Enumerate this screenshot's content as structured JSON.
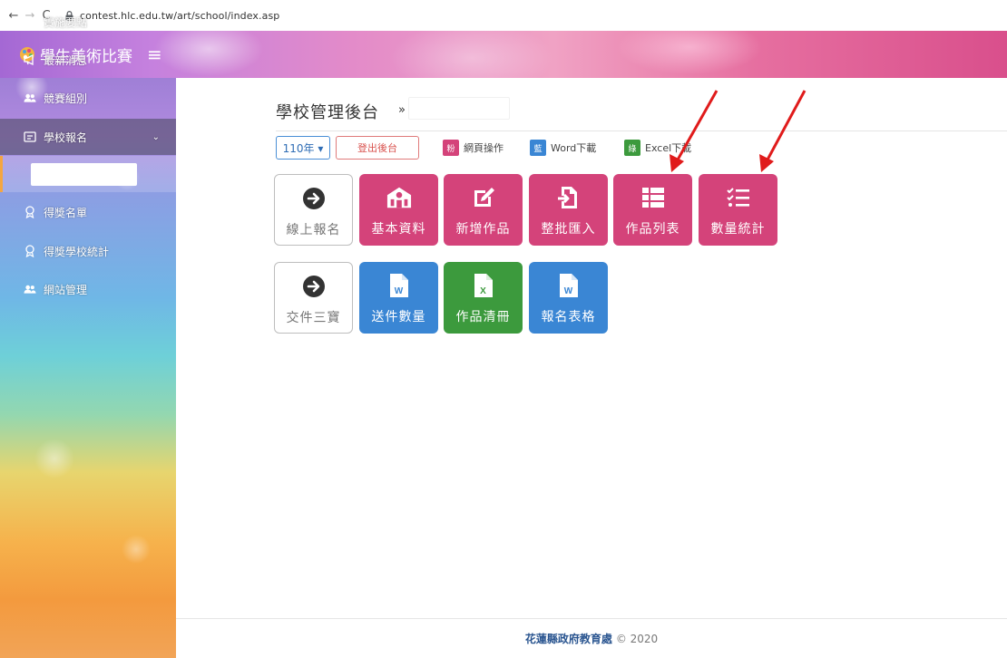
{
  "browser": {
    "back": "←",
    "forward": "→",
    "reload": "C",
    "url": "contest.hlc.edu.tw/art/school/index.asp"
  },
  "brand": {
    "title": "學生美術比賽",
    "menu_toggle": "≡"
  },
  "sidebar": {
    "items": [
      {
        "label": "實施要點",
        "icon": "file-icon"
      },
      {
        "label": "最新消息",
        "icon": "megaphone-icon"
      },
      {
        "label": "競賽組別",
        "icon": "users-icon"
      },
      {
        "label": "學校報名",
        "icon": "signup-icon",
        "active": true,
        "caret": "⌄"
      },
      {
        "label": "得獎名單",
        "icon": "award-icon"
      },
      {
        "label": "得獎學校統計",
        "icon": "award-icon"
      },
      {
        "label": "網站管理",
        "icon": "users-icon"
      }
    ]
  },
  "main": {
    "title": "學校管理後台",
    "raquo": "»",
    "year_select": "110年 ▾",
    "logout": "登出後台",
    "legend": [
      {
        "swatch": "粉",
        "label": "網頁操作",
        "color": "#d4437a"
      },
      {
        "swatch": "藍",
        "label": "Word下載",
        "color": "#3a86d4"
      },
      {
        "swatch": "綠",
        "label": "Excel下載",
        "color": "#3c9a3d"
      }
    ],
    "row1": [
      {
        "label": "線上報名",
        "icon": "arrow-circle-right-icon",
        "style": "outline"
      },
      {
        "label": "基本資料",
        "icon": "school-icon",
        "style": "pink"
      },
      {
        "label": "新增作品",
        "icon": "edit-icon",
        "style": "pink"
      },
      {
        "label": "整批匯入",
        "icon": "import-icon",
        "style": "pink"
      },
      {
        "label": "作品列表",
        "icon": "table-icon",
        "style": "pink"
      },
      {
        "label": "數量統計",
        "icon": "checklist-icon",
        "style": "pink"
      }
    ],
    "row2": [
      {
        "label": "交件三寶",
        "icon": "arrow-circle-right-icon",
        "style": "outline"
      },
      {
        "label": "送件數量",
        "icon": "word-file-icon",
        "style": "blue"
      },
      {
        "label": "作品清冊",
        "icon": "excel-file-icon",
        "style": "green"
      },
      {
        "label": "報名表格",
        "icon": "word-file-icon",
        "style": "blue"
      }
    ]
  },
  "footer": {
    "org": "花蓮縣政府教育處",
    "copyright": "© 2020"
  },
  "colors": {
    "pink": "#d4437a",
    "blue": "#3a86d4",
    "green": "#3c9a3d",
    "arrow": "#e01b1b"
  }
}
